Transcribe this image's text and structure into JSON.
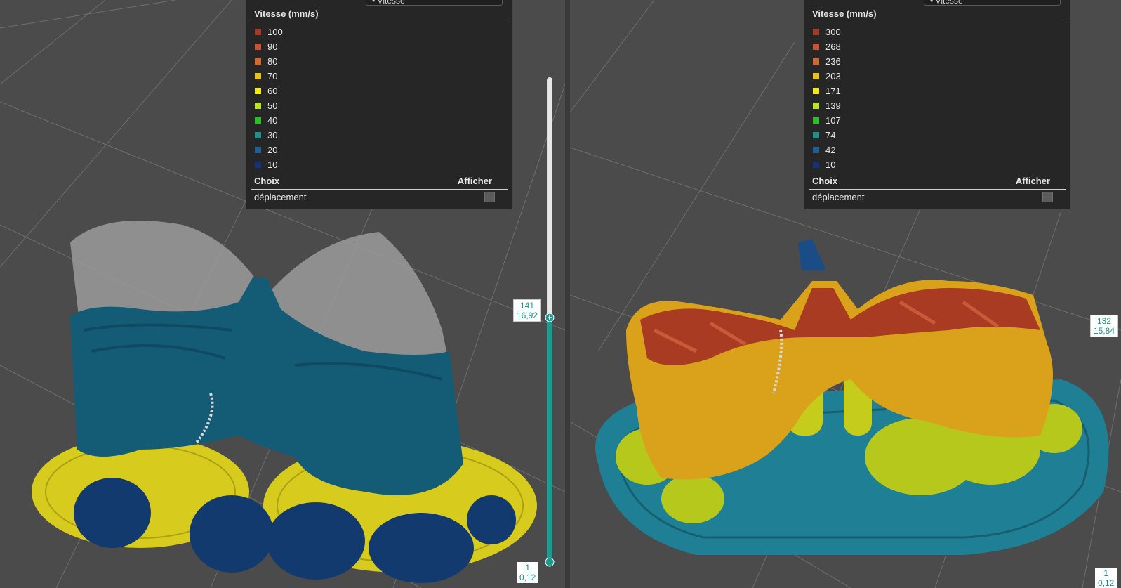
{
  "left_view": {
    "dropdown_text": "• Vitesse",
    "legend": {
      "title": "Vitesse (mm/s)",
      "items": [
        {
          "value": "100",
          "color": "#a43a26"
        },
        {
          "value": "90",
          "color": "#c8533a"
        },
        {
          "value": "80",
          "color": "#d4672e"
        },
        {
          "value": "70",
          "color": "#e6c21a"
        },
        {
          "value": "60",
          "color": "#f2ea10"
        },
        {
          "value": "50",
          "color": "#b7e61c"
        },
        {
          "value": "40",
          "color": "#25c41c"
        },
        {
          "value": "30",
          "color": "#1f8f8b"
        },
        {
          "value": "20",
          "color": "#1d5f95"
        },
        {
          "value": "10",
          "color": "#16307a"
        }
      ],
      "choice_header": "Choix",
      "show_header": "Afficher",
      "travel_label": "déplacement"
    },
    "top_layer": {
      "index": "141",
      "height": "16,92"
    },
    "bottom_layer": {
      "index": "1",
      "height": "0,12"
    },
    "slider_position": 0.49
  },
  "right_view": {
    "dropdown_text": "• Vitesse",
    "legend": {
      "title": "Vitesse (mm/s)",
      "items": [
        {
          "value": "300",
          "color": "#a43a26"
        },
        {
          "value": "268",
          "color": "#c8533a"
        },
        {
          "value": "236",
          "color": "#d4672e"
        },
        {
          "value": "203",
          "color": "#e6c21a"
        },
        {
          "value": "171",
          "color": "#f2ea10"
        },
        {
          "value": "139",
          "color": "#b7e61c"
        },
        {
          "value": "107",
          "color": "#25c41c"
        },
        {
          "value": "74",
          "color": "#1f8f8b"
        },
        {
          "value": "42",
          "color": "#1d5f95"
        },
        {
          "value": "10",
          "color": "#16307a"
        }
      ],
      "choice_header": "Choix",
      "show_header": "Afficher",
      "travel_label": "déplacement"
    },
    "top_layer": {
      "index": "132",
      "height": "15,84"
    },
    "bottom_layer": {
      "index": "1",
      "height": "0,12"
    }
  },
  "colors": {
    "accent": "#1b9b8f",
    "bed": "#4b4b4b",
    "panel": "#262626"
  }
}
